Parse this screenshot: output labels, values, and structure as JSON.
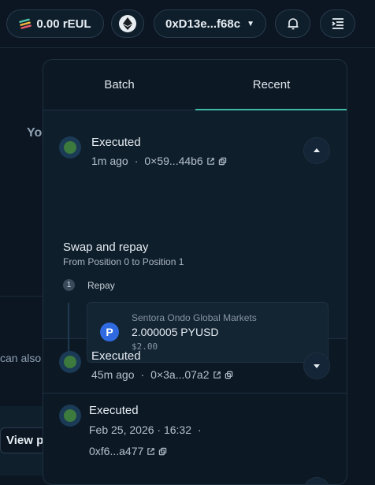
{
  "header": {
    "balance": "0.00 rEUL",
    "network_icon": "ethereum-icon",
    "address": "0xD13e...f68c",
    "bell_icon": "bell-icon",
    "menu_icon": "menu-icon"
  },
  "background": {
    "text_you": "Yo",
    "text_can_also": "can also",
    "view_button": "View p"
  },
  "panel": {
    "tabs": [
      {
        "label": "Batch",
        "active": false
      },
      {
        "label": "Recent",
        "active": true
      }
    ],
    "transactions": [
      {
        "status": "Executed",
        "time": "1m ago",
        "hash": "0×59...44b6",
        "expanded": true,
        "title": "Swap and repay",
        "subtitle": "From Position 0 to Position 1",
        "step_number": "1",
        "step_label": "Repay",
        "market": "Sentora Ondo Global Markets",
        "amount": "2.000005 PYUSD",
        "usd": "$2.00",
        "asset_icon": "P"
      },
      {
        "status": "Executed",
        "time": "45m ago",
        "hash": "0×3a...07a2",
        "expanded": false
      },
      {
        "status": "Executed",
        "date": "Feb 25, 2026 · 16:32",
        "hash": "0xf6...a477",
        "expanded": false
      }
    ]
  },
  "colors": {
    "background": "#0b1622",
    "panel": "#0c1824",
    "accent": "#3fb9a3",
    "status_green": "#3c7a3e",
    "pyusd_blue": "#2f6ae0"
  }
}
